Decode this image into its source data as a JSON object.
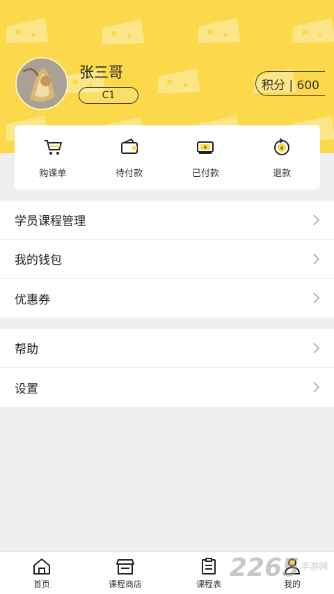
{
  "colors": {
    "accent": "#fbd94b",
    "background": "#efeff1"
  },
  "profile": {
    "name": "张三哥",
    "level": "C1",
    "points": "积分 | 600"
  },
  "orders": [
    {
      "label": "购课单",
      "icon": "cart-icon"
    },
    {
      "label": "待付款",
      "icon": "wallet-icon"
    },
    {
      "label": "已付款",
      "icon": "paid-cash-icon"
    },
    {
      "label": "退款",
      "icon": "refund-icon"
    }
  ],
  "menu_group1": [
    {
      "label": "学员课程管理"
    },
    {
      "label": "我的钱包"
    },
    {
      "label": "优惠券"
    }
  ],
  "menu_group2": [
    {
      "label": "帮助"
    },
    {
      "label": "设置"
    }
  ],
  "tabbar": [
    {
      "label": "首页",
      "icon": "home-icon"
    },
    {
      "label": "课程商店",
      "icon": "store-icon"
    },
    {
      "label": "课程表",
      "icon": "schedule-icon"
    },
    {
      "label": "我的",
      "icon": "profile-icon"
    }
  ],
  "watermark": {
    "number": "2265",
    "text": "手游网"
  }
}
